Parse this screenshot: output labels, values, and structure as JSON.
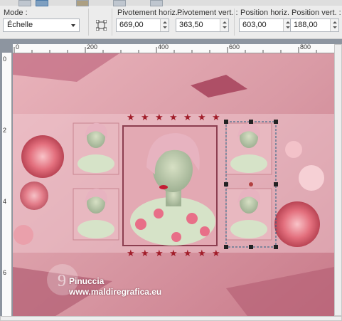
{
  "toolbar": {
    "mode": {
      "label": "Mode :",
      "value": "Échelle"
    },
    "pivot_h": {
      "label": "Pivotement horiz. :",
      "value": "669,00"
    },
    "pivot_v": {
      "label": "Pivotement vert. :",
      "value": "363,50"
    },
    "pos_h": {
      "label": "Position horiz. :",
      "value": "603,00"
    },
    "pos_v": {
      "label": "Position vert. :",
      "value": "188,00"
    }
  },
  "ruler": {
    "h_ticks": [
      "0",
      "200",
      "400",
      "600",
      "800"
    ],
    "v_ticks": [
      "0",
      "2",
      "4",
      "6"
    ]
  },
  "watermark": {
    "line1": "Pinuccia",
    "line2": "www.maldiregrafica.eu"
  },
  "colors": {
    "bg_pink": "#e8aab3",
    "deep_pink": "#b7566b",
    "selection": "#1e5f82"
  }
}
